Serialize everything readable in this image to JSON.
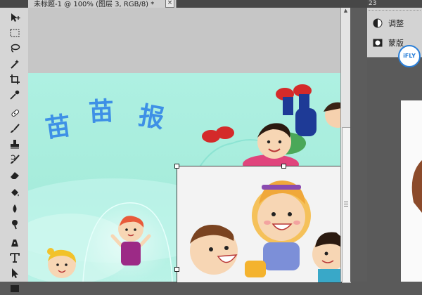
{
  "document_tab": {
    "title": "未标题-1 @ 100% (图层 3, RGB/8) *",
    "close": "×"
  },
  "tools": [
    {
      "icon": "move-tool-icon"
    },
    {
      "icon": "rectangular-marquee-icon"
    },
    {
      "icon": "lasso-icon"
    },
    {
      "icon": "magic-wand-icon"
    },
    {
      "icon": "crop-icon"
    },
    {
      "icon": "eyedropper-icon"
    },
    {
      "icon": "healing-brush-icon"
    },
    {
      "icon": "brush-icon"
    },
    {
      "icon": "clone-stamp-icon"
    },
    {
      "icon": "history-brush-icon"
    },
    {
      "icon": "eraser-icon"
    },
    {
      "icon": "paint-bucket-icon"
    },
    {
      "icon": "blur-icon"
    },
    {
      "icon": "dodge-icon"
    },
    {
      "icon": "pen-icon"
    },
    {
      "icon": "type-icon"
    },
    {
      "icon": "path-selection-icon"
    },
    {
      "icon": "rectangle-shape-icon"
    }
  ],
  "canvas": {
    "title_chars": [
      "苗",
      "苗",
      "报"
    ]
  },
  "panel": {
    "header": "23",
    "items": [
      {
        "label": "调整",
        "icon": "adjustment-icon"
      },
      {
        "label": "蒙版",
        "icon": "mask-icon"
      }
    ]
  },
  "watermark": "iFLY"
}
